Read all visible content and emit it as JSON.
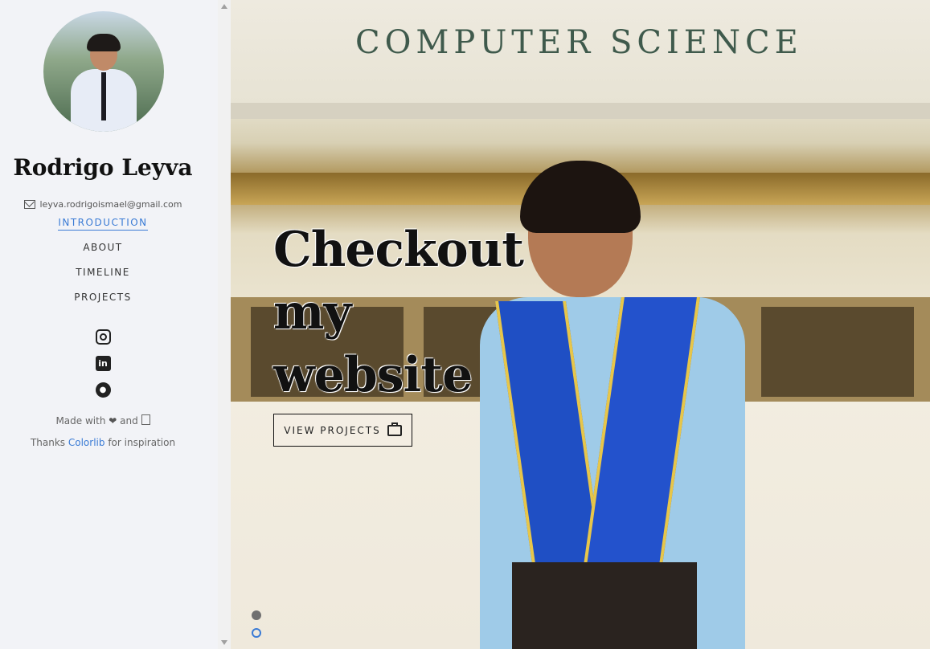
{
  "profile": {
    "name": "Rodrigo Leyva",
    "email": "leyva.rodrigoismael@gmail.com"
  },
  "nav": {
    "items": [
      {
        "label": "INTRODUCTION",
        "active": true
      },
      {
        "label": "ABOUT",
        "active": false
      },
      {
        "label": "TIMELINE",
        "active": false
      },
      {
        "label": "PROJECTS",
        "active": false
      }
    ]
  },
  "social": {
    "icons": [
      "instagram-icon",
      "linkedin-icon",
      "github-icon"
    ]
  },
  "footer": {
    "made_with": "Made with",
    "and": "and",
    "thanks": "Thanks",
    "colorlib": "Colorlib",
    "inspiration": "for inspiration"
  },
  "hero": {
    "building_sign": "COMPUTER SCIENCE",
    "headline_line1": "Checkout",
    "headline_line2": "my",
    "headline_line3": "website",
    "cta_label": "VIEW PROJECTS",
    "slide_count": 2,
    "active_slide": 1
  },
  "colors": {
    "accent": "#3a7bd5",
    "sidebar_bg": "#f2f3f7"
  }
}
